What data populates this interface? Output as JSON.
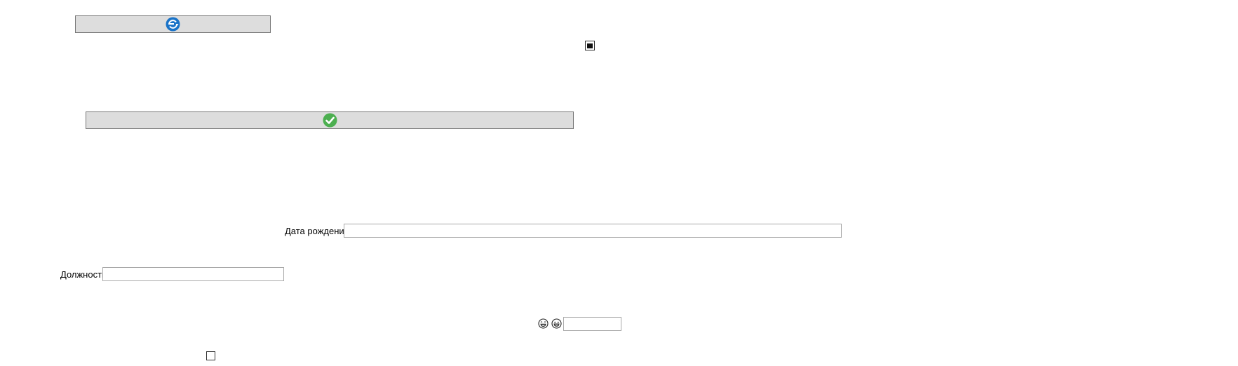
{
  "buttons": {
    "refresh_icon": "refresh-cycle-icon",
    "confirm_icon": "check-circle-icon",
    "colors": {
      "button_bg": "#dddddd",
      "refresh_blue": "#1a73c8",
      "confirm_green": "#4caf50"
    }
  },
  "form": {
    "birth_date": {
      "label": "Дата рождения",
      "value": ""
    },
    "position": {
      "label": "Должность",
      "value": ""
    },
    "emoji_field": {
      "value": ""
    }
  },
  "checkboxes": {
    "top_checked": true,
    "bottom_checked": false
  }
}
